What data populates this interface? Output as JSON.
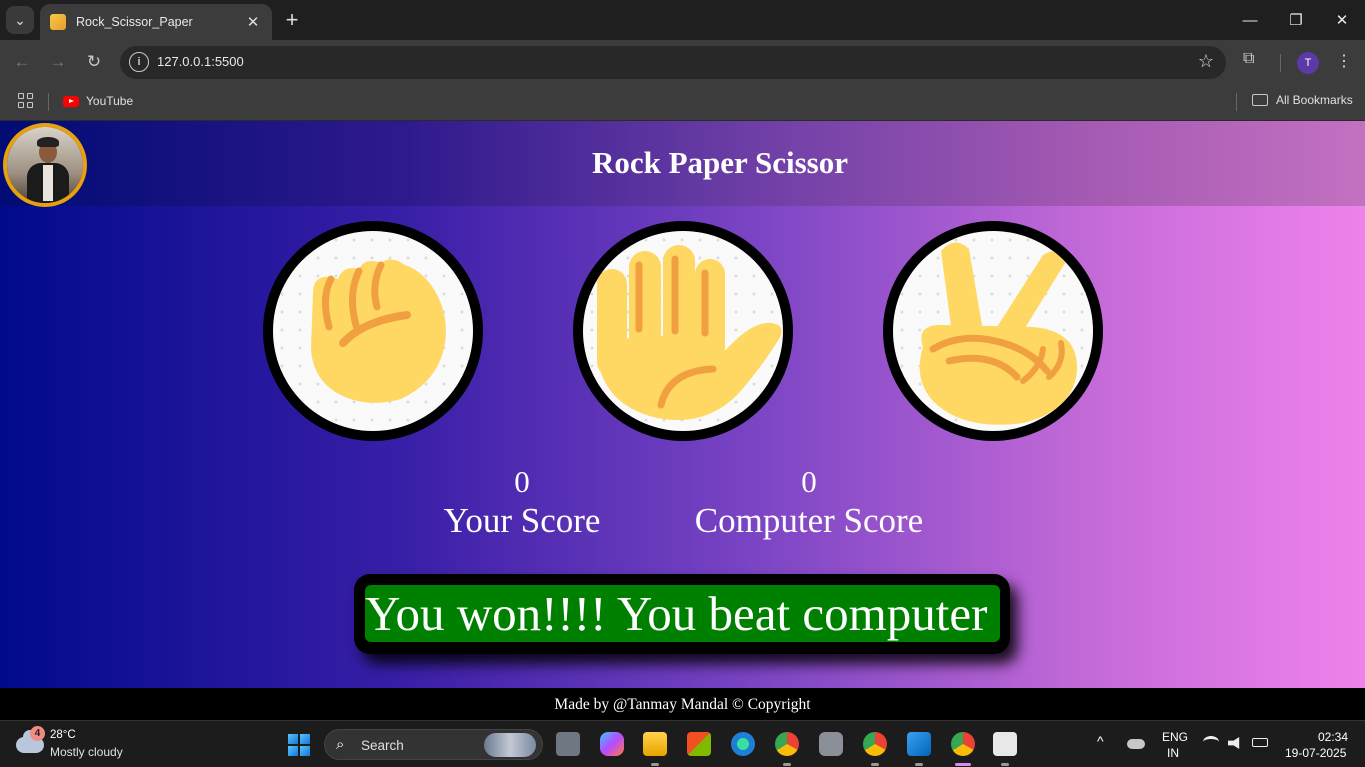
{
  "browser": {
    "tab_title": "Rock_Scissor_Paper",
    "tab_close": "✕",
    "new_tab": "+",
    "url": "127.0.0.1:5500",
    "bookmarks": [
      {
        "label": "YouTube",
        "icon": "youtube-icon"
      }
    ],
    "all_bookmarks": "All Bookmarks",
    "profile_initial": "T",
    "window_controls": {
      "minimize": "—",
      "restore": "❐",
      "close": "✕"
    },
    "nav": {
      "back": "←",
      "forward": "→",
      "reload": "↻",
      "info": "i",
      "star": "☆",
      "menu": "⋮",
      "tab_menu": "⌄",
      "extensions": "⧉"
    }
  },
  "page": {
    "title": "Rock Paper Scissor",
    "choices": [
      {
        "id": "rock",
        "icon": "rock-fist-icon"
      },
      {
        "id": "paper",
        "icon": "paper-hand-icon"
      },
      {
        "id": "scissor",
        "icon": "scissor-victory-icon"
      }
    ],
    "scores": {
      "user_score": "0",
      "user_label": "Your Score",
      "computer_score": "0",
      "computer_label": "Computer Score"
    },
    "message": "You won!!!! You beat computer",
    "message_color": "#008000",
    "footer": "Made by @Tanmay Mandal © Copyright"
  },
  "taskbar": {
    "weather_badge": "4",
    "temperature": "28°C",
    "weather_desc": "Mostly cloudy",
    "search_label": "Search",
    "search_icon": "⌕",
    "tray_chevron": "^",
    "language": "ENG",
    "region": "IN",
    "time": "02:34",
    "date": "19-07-2025"
  }
}
